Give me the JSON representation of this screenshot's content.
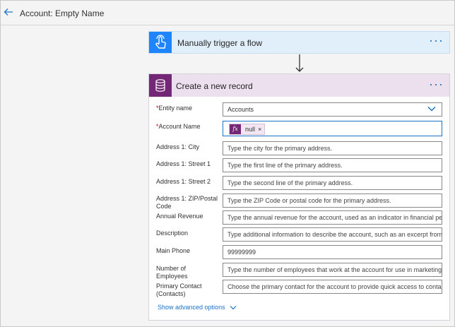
{
  "header": {
    "title": "Account: Empty Name"
  },
  "trigger_card": {
    "title": "Manually trigger a flow",
    "more": "···"
  },
  "action_card": {
    "title": "Create a new record",
    "more": "···",
    "fields": [
      {
        "label": "Entity name",
        "required": true,
        "value": "Accounts",
        "type": "dropdown"
      },
      {
        "label": "Account Name",
        "required": true,
        "token": "null",
        "type": "token"
      },
      {
        "label": "Address 1: City",
        "placeholder": "Type the city for the primary address."
      },
      {
        "label": "Address 1: Street 1",
        "placeholder": "Type the first line of the primary address."
      },
      {
        "label": "Address 1: Street 2",
        "placeholder": "Type the second line of the primary address."
      },
      {
        "label": "Address 1: ZIP/Postal Code",
        "placeholder": "Type the ZIP Code or postal code for the primary address."
      },
      {
        "label": "Annual Revenue",
        "placeholder": "Type the annual revenue for the account, used as an indicator in financial perfo"
      },
      {
        "label": "Description",
        "placeholder": "Type additional information to describe the account, such as an excerpt from th"
      },
      {
        "label": "Main Phone",
        "value": "99999999"
      },
      {
        "label": "Number of Employees",
        "placeholder": "Type the number of employees that work at the account for use in marketing se"
      },
      {
        "label": "Primary Contact (Contacts)",
        "placeholder": "Choose the primary contact for the account to provide quick access to contact"
      }
    ],
    "advanced_label": "Show advanced options"
  },
  "colors": {
    "accent": "#1a73c9",
    "trigger_icon": "#1f85ff",
    "dataverse_icon": "#742774",
    "required": "#c4000c"
  }
}
